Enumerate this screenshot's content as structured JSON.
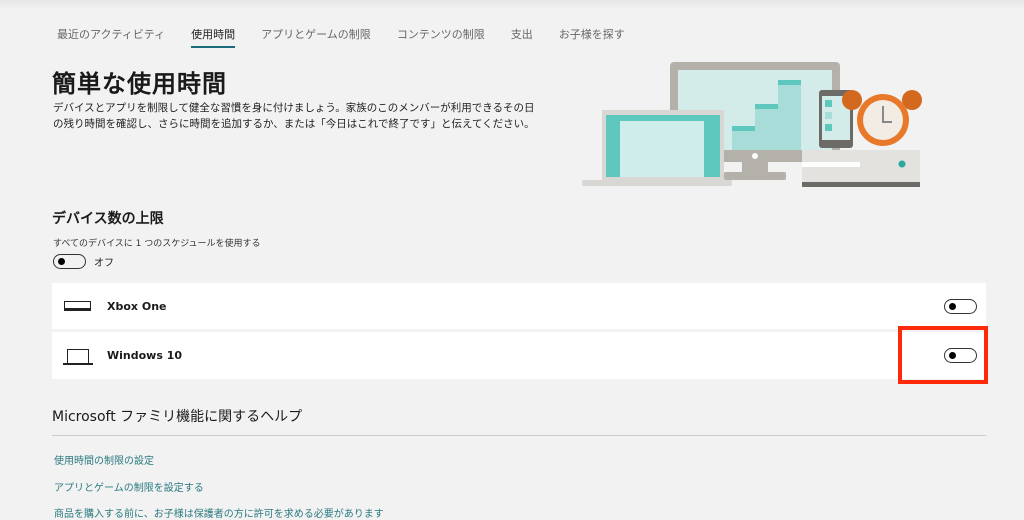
{
  "tabs": [
    {
      "label": "最近のアクティビティ"
    },
    {
      "label": "使用時間",
      "active": true
    },
    {
      "label": "アプリとゲームの制限"
    },
    {
      "label": "コンテンツの制限"
    },
    {
      "label": "支出"
    },
    {
      "label": "お子様を探す"
    }
  ],
  "page": {
    "title": "簡単な使用時間",
    "description": "デバイスとアプリを制限して健全な習慣を身に付けましょう。家族のこのメンバーが利用できるその日の残り時間を確認し、さらに時間を追加するか、または「今日はこれで終了です」と伝えてください。"
  },
  "device_limits": {
    "heading": "デバイス数の上限",
    "schedule_label": "すべてのデバイスに 1 つのスケジュールを使用する",
    "schedule_toggle_state": "オフ",
    "devices": [
      {
        "name": "Xbox One",
        "icon": "xbox-console-icon",
        "enabled": false
      },
      {
        "name": "Windows 10",
        "icon": "laptop-icon",
        "enabled": false
      }
    ]
  },
  "help": {
    "heading": "Microsoft ファミリ機能に関するヘルプ",
    "links": [
      "使用時間の制限の設定",
      "アプリとゲームの制限を設定する",
      "商品を購入する前に、お子様は保護者の方に許可を求める必要があります"
    ]
  },
  "colors": {
    "accent": "#1b6b7a",
    "link": "#2a7a80",
    "highlight": "#ff2a0a",
    "teal": "#5ec8bf",
    "orange": "#e8792a"
  }
}
